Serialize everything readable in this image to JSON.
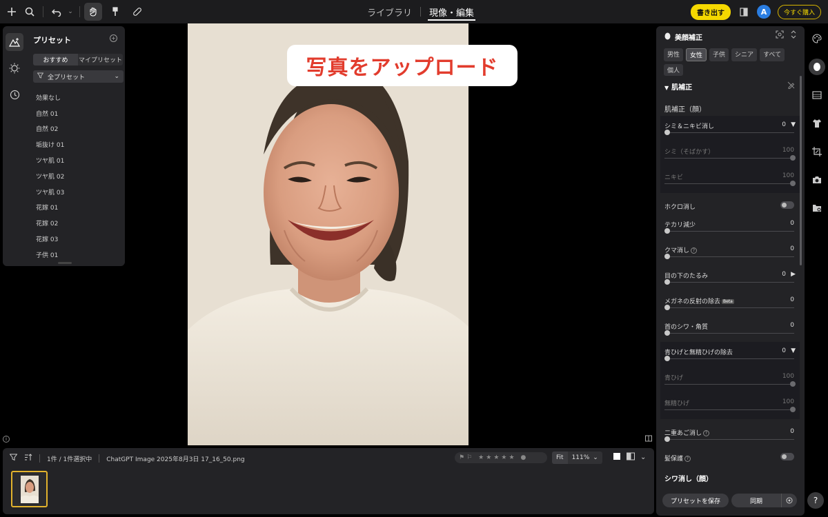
{
  "topbar": {
    "tabs": [
      {
        "label": "ライブラリ",
        "active": false
      },
      {
        "label": "現像・編集",
        "active": true
      }
    ],
    "export_label": "書き出す",
    "avatar_initial": "A",
    "buy_label": "今すぐ購入",
    "icons": [
      "plus-icon",
      "search-icon",
      "undo-icon",
      "chevron-down-icon",
      "hand-icon",
      "brush-icon",
      "bandage-icon"
    ]
  },
  "presets": {
    "title": "プリセット",
    "segments": [
      {
        "label": "おすすめ",
        "active": true
      },
      {
        "label": "マイプリセット",
        "active": false
      }
    ],
    "filter_label": "全プリセット",
    "items": [
      "効果なし",
      "自然 01",
      "自然 02",
      "垢抜け 01",
      "ツヤ肌 01",
      "ツヤ肌 02",
      "ツヤ肌 03",
      "花嫁 01",
      "花嫁 02",
      "花嫁 03",
      "子供 01"
    ]
  },
  "overlay": {
    "upload_text": "写真をアップロード"
  },
  "beauty": {
    "title": "美顔補正",
    "tags": [
      {
        "label": "男性",
        "active": false
      },
      {
        "label": "女性",
        "active": true
      },
      {
        "label": "子供",
        "active": false
      },
      {
        "label": "シニア",
        "active": false
      },
      {
        "label": "すべて",
        "active": false
      },
      {
        "label": "個人",
        "active": false
      }
    ],
    "section": "肌補正",
    "subsection": "肌補正（顔）",
    "spots": {
      "label": "シミ＆ニキビ消し",
      "value": "0"
    },
    "freckles": {
      "label": "シミ（そばかす）",
      "value": "100"
    },
    "acne": {
      "label": "ニキビ",
      "value": "100"
    },
    "moles": {
      "label": "ホクロ消し"
    },
    "shine": {
      "label": "テカリ減少",
      "value": "0"
    },
    "dark_circles": {
      "label": "クマ消し",
      "value": "0"
    },
    "eye_bags": {
      "label": "目の下のたるみ",
      "value": "0"
    },
    "glasses": {
      "label": "メガネの反射の除去",
      "beta": "Beta",
      "value": "0"
    },
    "neck": {
      "label": "首のシワ・角質",
      "value": "0"
    },
    "beard": {
      "label": "青ひげと無精ひげの除去",
      "value": "0"
    },
    "blue_beard": {
      "label": "青ひげ",
      "value": "100"
    },
    "stubble": {
      "label": "無精ひげ",
      "value": "100"
    },
    "double_chin": {
      "label": "二重あご消し",
      "value": "0"
    },
    "hair_protect": {
      "label": "髪保護"
    },
    "wrinkle_section": "シワ消し（顔）",
    "save_preset_label": "プリセットを保存",
    "sync_label": "同期"
  },
  "filmstrip": {
    "selection": "1件 / 1件選択中",
    "filename": "ChatGPT Image 2025年8月3日 17_16_50.png",
    "rating_stars": 0,
    "fit_label": "Fit",
    "zoom_label": "111%"
  },
  "colors": {
    "accent_yellow": "#f5d800",
    "upload_red": "#e23c2d",
    "avatar_blue": "#2a7de1"
  }
}
